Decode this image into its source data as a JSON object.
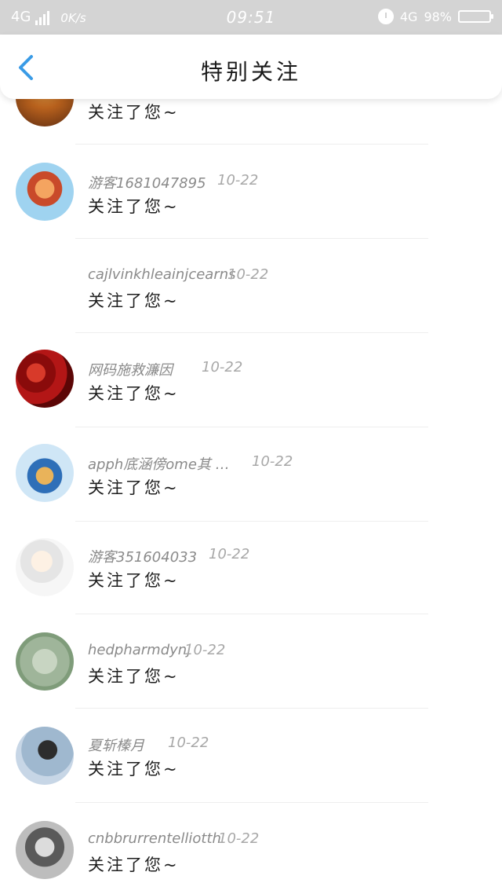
{
  "status_bar": {
    "network": "4G",
    "speed": "0K/s",
    "time": "09:51",
    "network_right": "4G",
    "battery": "98%"
  },
  "header": {
    "title": "特别关注",
    "back_icon": "chevron-left-icon"
  },
  "colors": {
    "accent": "#3a9be6",
    "status_bar_bg": "#d4d4d4"
  },
  "follow_list": [
    {
      "name": "",
      "date": "",
      "message": "关注了您~"
    },
    {
      "name": "游客1681047895",
      "date": "10-22",
      "message": "关注了您~"
    },
    {
      "name": "cajlvinkhleainjcearns",
      "date": "10-22",
      "message": "关注了您~"
    },
    {
      "name": "网码施救濂因",
      "date": "10-22",
      "message": "关注了您~"
    },
    {
      "name": "apph底涵傍ome其 …",
      "date": "10-22",
      "message": "关注了您~"
    },
    {
      "name": "游客351604033",
      "date": "10-22",
      "message": "关注了您~"
    },
    {
      "name": "hedpharmdynj",
      "date": "10-22",
      "message": "关注了您~"
    },
    {
      "name": "夏斩榛月",
      "date": "10-22",
      "message": "关注了您~"
    },
    {
      "name": "cnbbrurrentelliotth",
      "date": "10-22",
      "message": "关注了您~"
    }
  ]
}
